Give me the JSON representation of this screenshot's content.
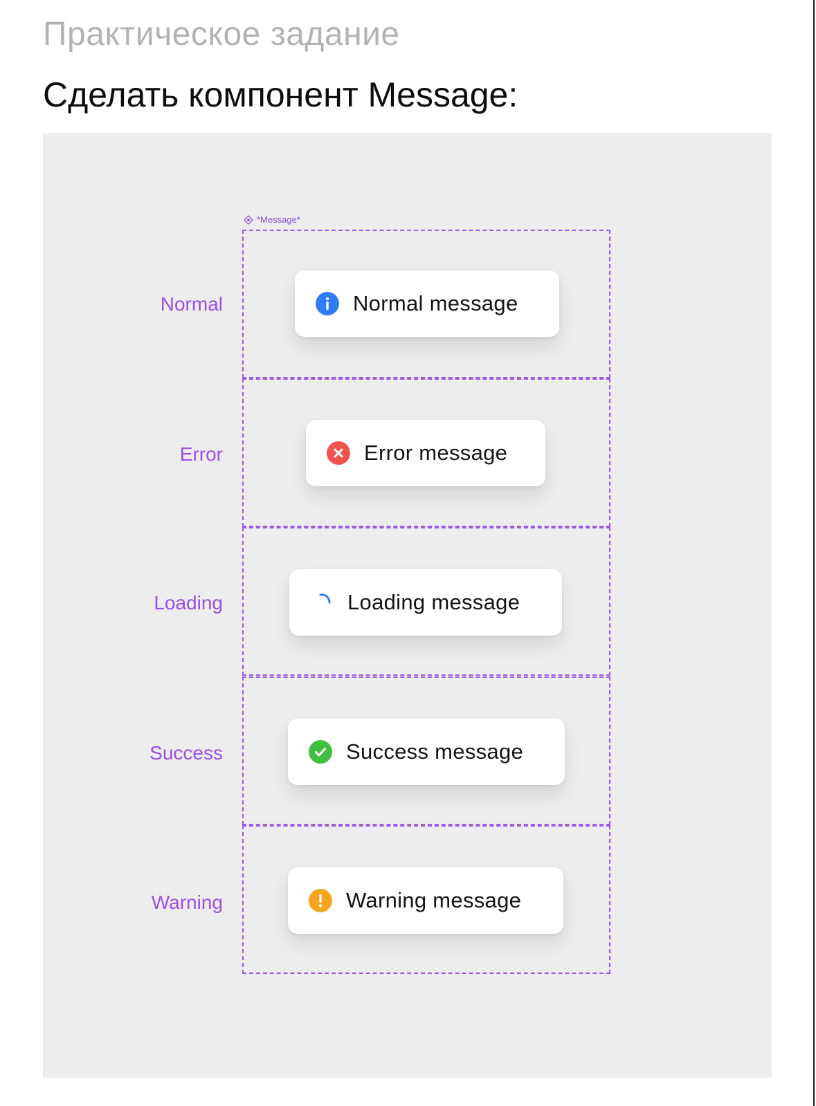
{
  "header": {
    "subtitle": "Практическое задание",
    "title": "Сделать компонент Message:"
  },
  "component_frame": {
    "label": "*Message*",
    "icon": "component-diamond-icon",
    "border_color": "#9b59e8"
  },
  "variants": [
    {
      "label": "Normal",
      "message": "Normal message",
      "icon": "info-icon",
      "icon_color": "#2f7cf6"
    },
    {
      "label": "Error",
      "message": "Error message",
      "icon": "error-icon",
      "icon_color": "#f0524f"
    },
    {
      "label": "Loading",
      "message": "Loading message",
      "icon": "loading-spinner-icon",
      "icon_color": "#2f7cf6"
    },
    {
      "label": "Success",
      "message": "Success message",
      "icon": "success-icon",
      "icon_color": "#3fbf3f"
    },
    {
      "label": "Warning",
      "message": "Warning message",
      "icon": "warning-icon",
      "icon_color": "#f6a51f"
    }
  ],
  "colors": {
    "variant_label": "#9b4fe3",
    "canvas_background": "#ededed",
    "card_background": "#ffffff"
  }
}
